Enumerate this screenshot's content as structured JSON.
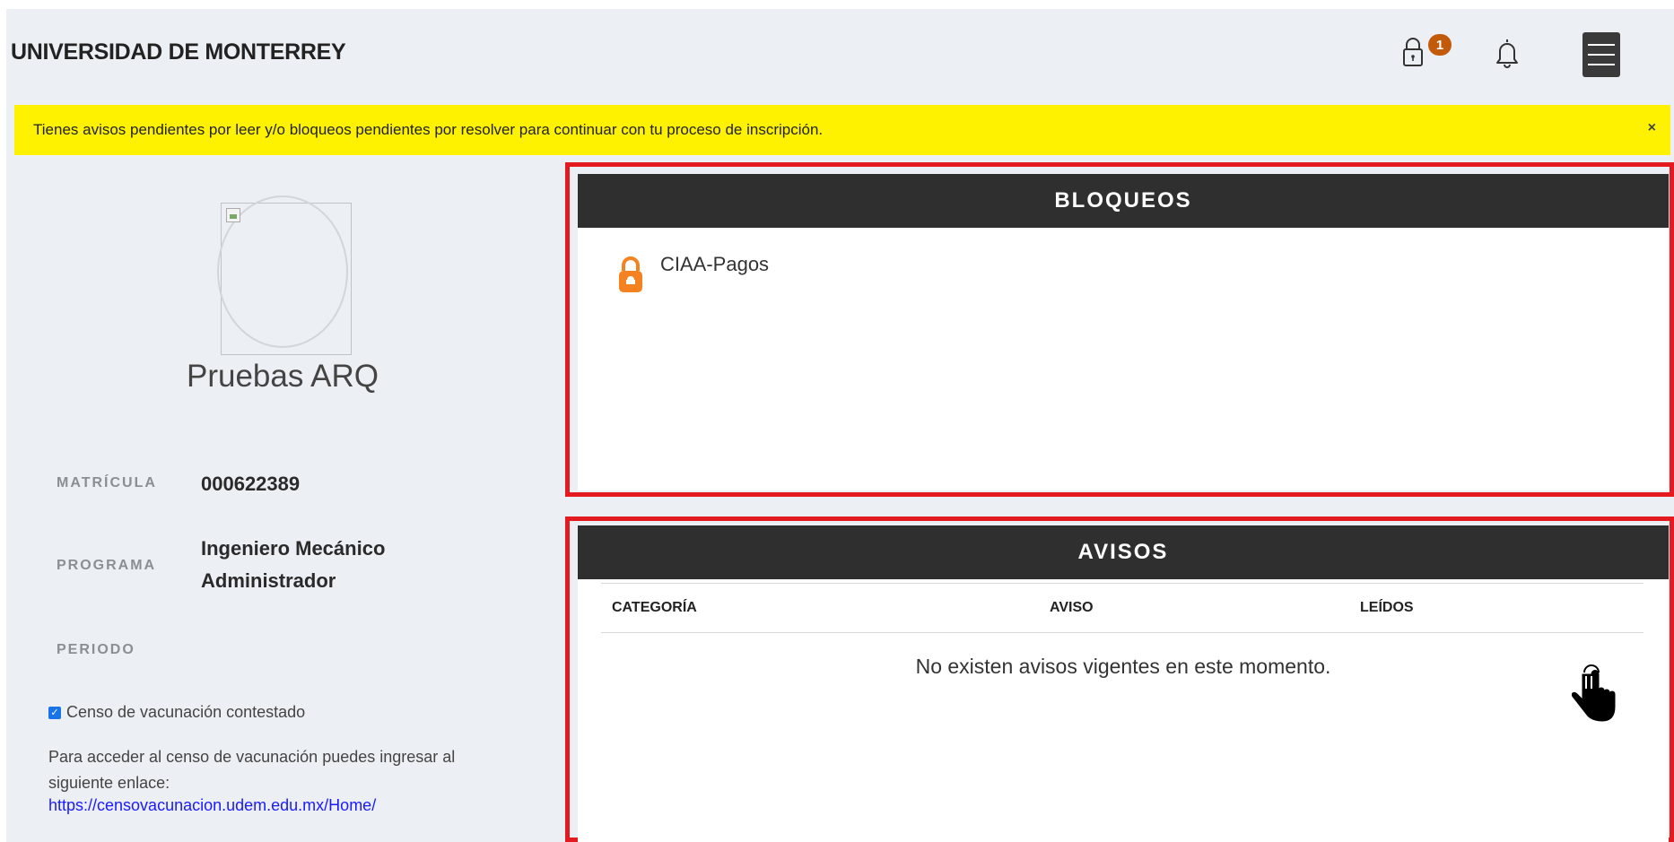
{
  "header": {
    "title": "UNIVERSIDAD DE MONTERREY",
    "lock_badge_count": "1",
    "icons": [
      "lock-icon",
      "bell-icon",
      "hamburger-menu-icon"
    ]
  },
  "alert": {
    "message": "Tienes avisos pendientes por leer y/o bloqueos pendientes por resolver para continuar con tu proceso de inscripción.",
    "close_label": "×"
  },
  "profile": {
    "name": "Pruebas ARQ",
    "matricula_label": "MATRÍCULA",
    "matricula_value": "000622389",
    "programa_label": "PROGRAMA",
    "programa_value_line1": "Ingeniero Mecánico",
    "programa_value_line2": "Administrador",
    "periodo_label": "PERIODO",
    "periodo_value": ""
  },
  "vaccination": {
    "checkbox_label": "Censo de vacunación contestado",
    "checked": true,
    "info_text": "Para acceder al censo de vacunación puedes ingresar al siguiente enlace:",
    "link": "https://censovacunacion.udem.edu.mx/Home/"
  },
  "bloqueos": {
    "title": "BLOQUEOS",
    "items": [
      {
        "label": "CIAA-Pagos",
        "icon": "orange-lock-icon"
      }
    ]
  },
  "avisos": {
    "title": "AVISOS",
    "columns": [
      "CATEGORÍA",
      "AVISO",
      "LEÍDOS"
    ],
    "empty_message": "No existen avisos vigentes en este momento."
  },
  "colors": {
    "alert_bg": "#fff200",
    "badge": "#c25a0a",
    "panel_header": "#2f2f2f",
    "highlight_outline": "#e31a1f",
    "lock_orange": "#f58220",
    "link": "#1a1aff"
  }
}
